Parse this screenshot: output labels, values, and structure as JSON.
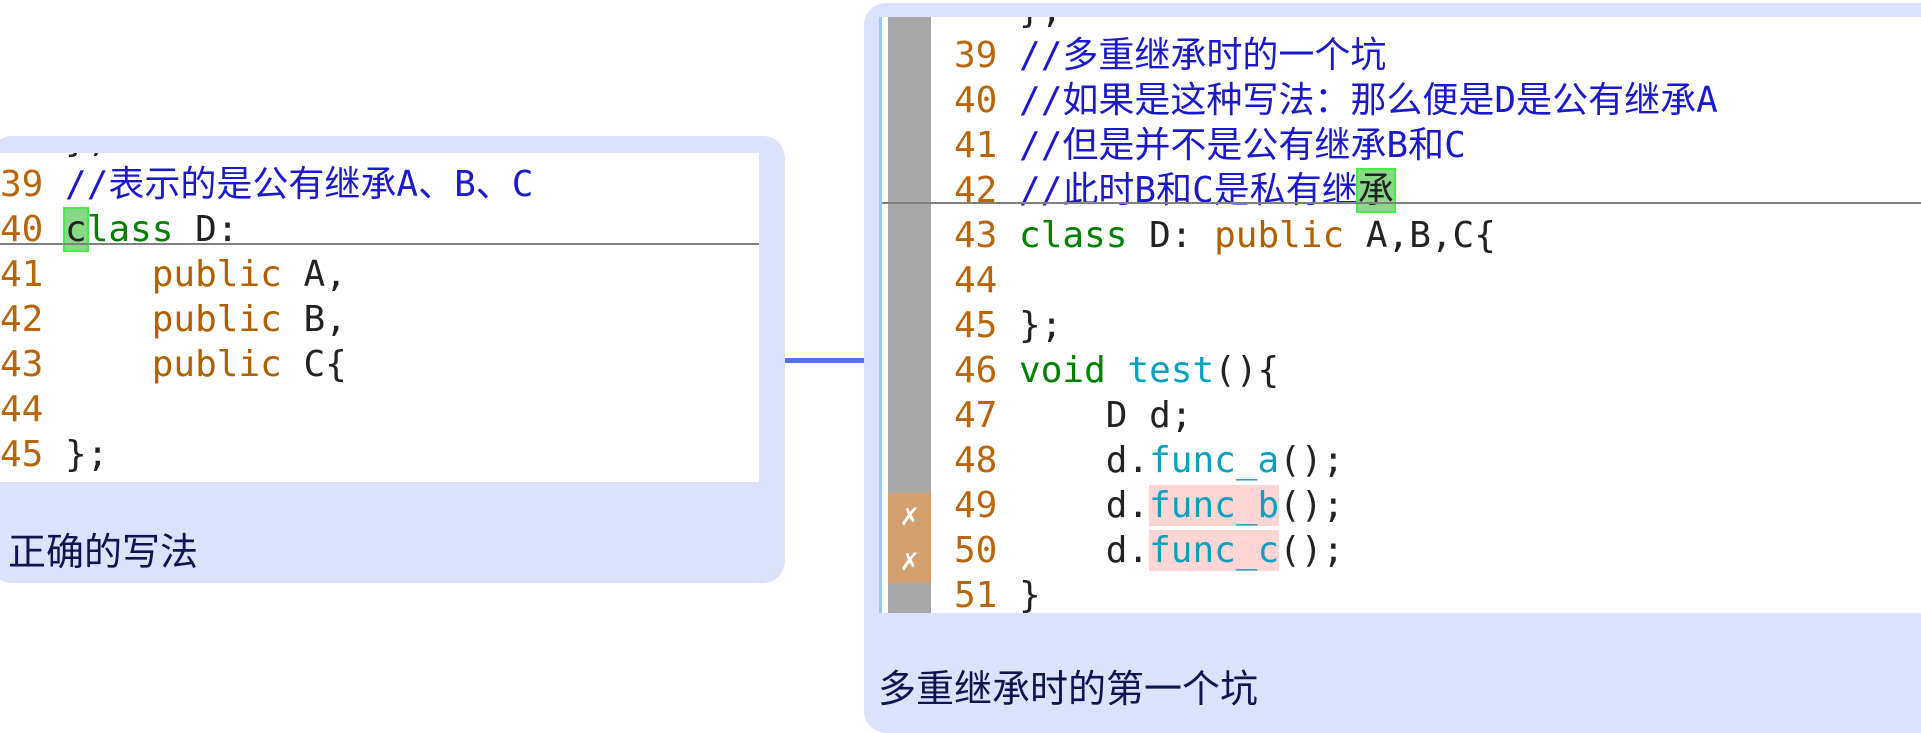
{
  "left_card": {
    "caption": "正确的写法",
    "lines": [
      {
        "num": "39",
        "text": "//表示的是公有继承A、B、C"
      },
      {
        "num": "40",
        "kw": "class",
        "rest": " D:"
      },
      {
        "num": "41",
        "indent": "    ",
        "kw": "public",
        "rest": " A,"
      },
      {
        "num": "42",
        "indent": "    ",
        "kw": "public",
        "rest": " B,"
      },
      {
        "num": "43",
        "indent": "    ",
        "kw": "public",
        "rest": " C{"
      },
      {
        "num": "44"
      },
      {
        "num": "45",
        "rest": "};"
      }
    ]
  },
  "right_card": {
    "caption": "多重继承时的第一个坑",
    "lines": [
      {
        "num": "39",
        "text": "//多重继承时的一个坑"
      },
      {
        "num": "40",
        "text": "//如果是这种写法：那么便是D是公有继承A"
      },
      {
        "num": "41",
        "text": "//但是并不是公有继承B和C"
      },
      {
        "num": "42",
        "text": "//此时B和C是私有继",
        "highlight": "承"
      },
      {
        "num": "43",
        "kw": "class",
        "mid": " D: ",
        "pub": "public",
        "rest": " A,B,C{"
      },
      {
        "num": "44"
      },
      {
        "num": "45",
        "rest": "};"
      },
      {
        "num": "46",
        "kw": "void",
        "fn": "test",
        "rest": "(){"
      },
      {
        "num": "47",
        "rest": "    D d;"
      },
      {
        "num": "48",
        "pre": "    d.",
        "fn": "func_a",
        "rest": "();"
      },
      {
        "num": "49",
        "pre": "    d.",
        "fn": "func_b",
        "rest": "();",
        "error": true
      },
      {
        "num": "50",
        "pre": "    d.",
        "fn": "func_c",
        "rest": "();",
        "error": true
      },
      {
        "num": "51",
        "rest": "}"
      }
    ],
    "error_marker": "✗"
  },
  "colors": {
    "card": "#dce1fc",
    "connector": "#5b70f0",
    "line_number": "#b8650b",
    "comment": "#1a1acc",
    "keyword": "#008000",
    "function": "#0aa0c0"
  }
}
